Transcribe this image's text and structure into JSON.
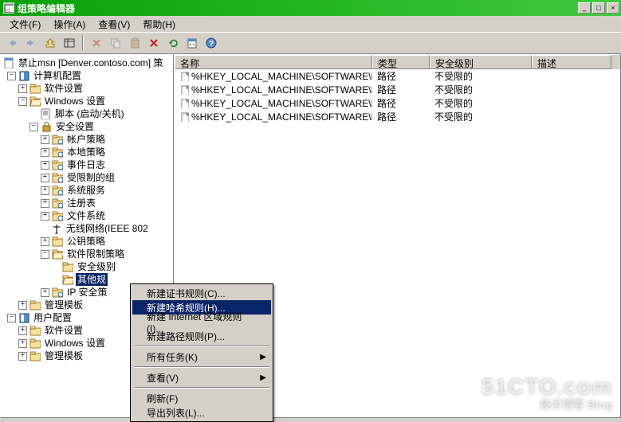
{
  "window": {
    "title": "组策略编辑器"
  },
  "menu": {
    "file": "文件(F)",
    "action": "操作(A)",
    "view": "查看(V)",
    "help": "帮助(H)"
  },
  "tree": {
    "root": "禁止msn [Denver.contoso.com] 策",
    "computer_config": "计算机配置",
    "software_settings": "软件设置",
    "windows_settings": "Windows 设置",
    "scripts": "脚本 (启动/关机)",
    "security_settings": "安全设置",
    "account_policy": "帐户策略",
    "local_policy": "本地策略",
    "event_log": "事件日志",
    "restricted_groups": "受限制的组",
    "system_services": "系统服务",
    "registry": "注册表",
    "file_system": "文件系统",
    "wireless": "无线网络(IEEE 802",
    "public_key": "公钥策略",
    "software_restriction": "软件限制策略",
    "security_level": "安全级别",
    "other_rules": "其他规",
    "ip_security": "IP 安全策",
    "admin_templates": "管理模板",
    "user_config": "用户配置",
    "u_software_settings": "软件设置",
    "u_windows_settings": "Windows 设置",
    "u_admin_templates": "管理模板"
  },
  "list": {
    "columns": {
      "name": "名称",
      "type": "类型",
      "security_level": "安全级别",
      "description": "描述"
    },
    "rows": [
      {
        "name": "%HKEY_LOCAL_MACHINE\\SOFTWARE\\Micro...",
        "type": "路径",
        "level": "不受限的"
      },
      {
        "name": "%HKEY_LOCAL_MACHINE\\SOFTWARE\\Micro...",
        "type": "路径",
        "level": "不受限的"
      },
      {
        "name": "%HKEY_LOCAL_MACHINE\\SOFTWARE\\Micro...",
        "type": "路径",
        "level": "不受限的"
      },
      {
        "name": "%HKEY_LOCAL_MACHINE\\SOFTWARE\\Micro...",
        "type": "路径",
        "level": "不受限的"
      }
    ]
  },
  "context_menu": {
    "new_cert_rule": "新建证书规则(C)...",
    "new_hash_rule": "新建哈希规则(H)...",
    "new_internet_rule": "新建 Internet 区域规则(I)...",
    "new_path_rule": "新建路径规则(P)...",
    "all_tasks": "所有任务(K)",
    "view": "查看(V)",
    "refresh": "刷新(F)",
    "export_list": "导出列表(L)..."
  },
  "watermark": {
    "line1": "51CTO.com",
    "line2": "技术博客   Blog"
  }
}
